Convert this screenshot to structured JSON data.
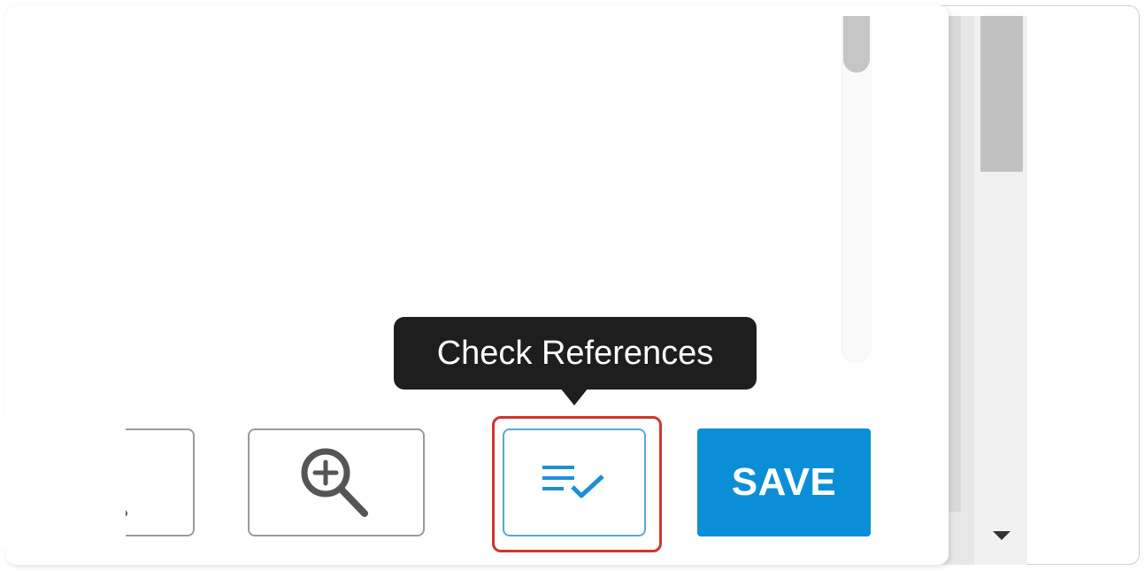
{
  "tooltip": {
    "text": "Check References"
  },
  "toolbar": {
    "zoom_out_icon": "zoom-out-icon",
    "zoom_in_icon": "zoom-in-icon",
    "check_references_icon": "check-list-icon",
    "save_label": "SAVE"
  },
  "colors": {
    "save_bg": "#0a8fd6",
    "check_icon": "#1d8fd8",
    "highlight": "#d0342c",
    "tooltip_bg": "#1e1e1e"
  }
}
